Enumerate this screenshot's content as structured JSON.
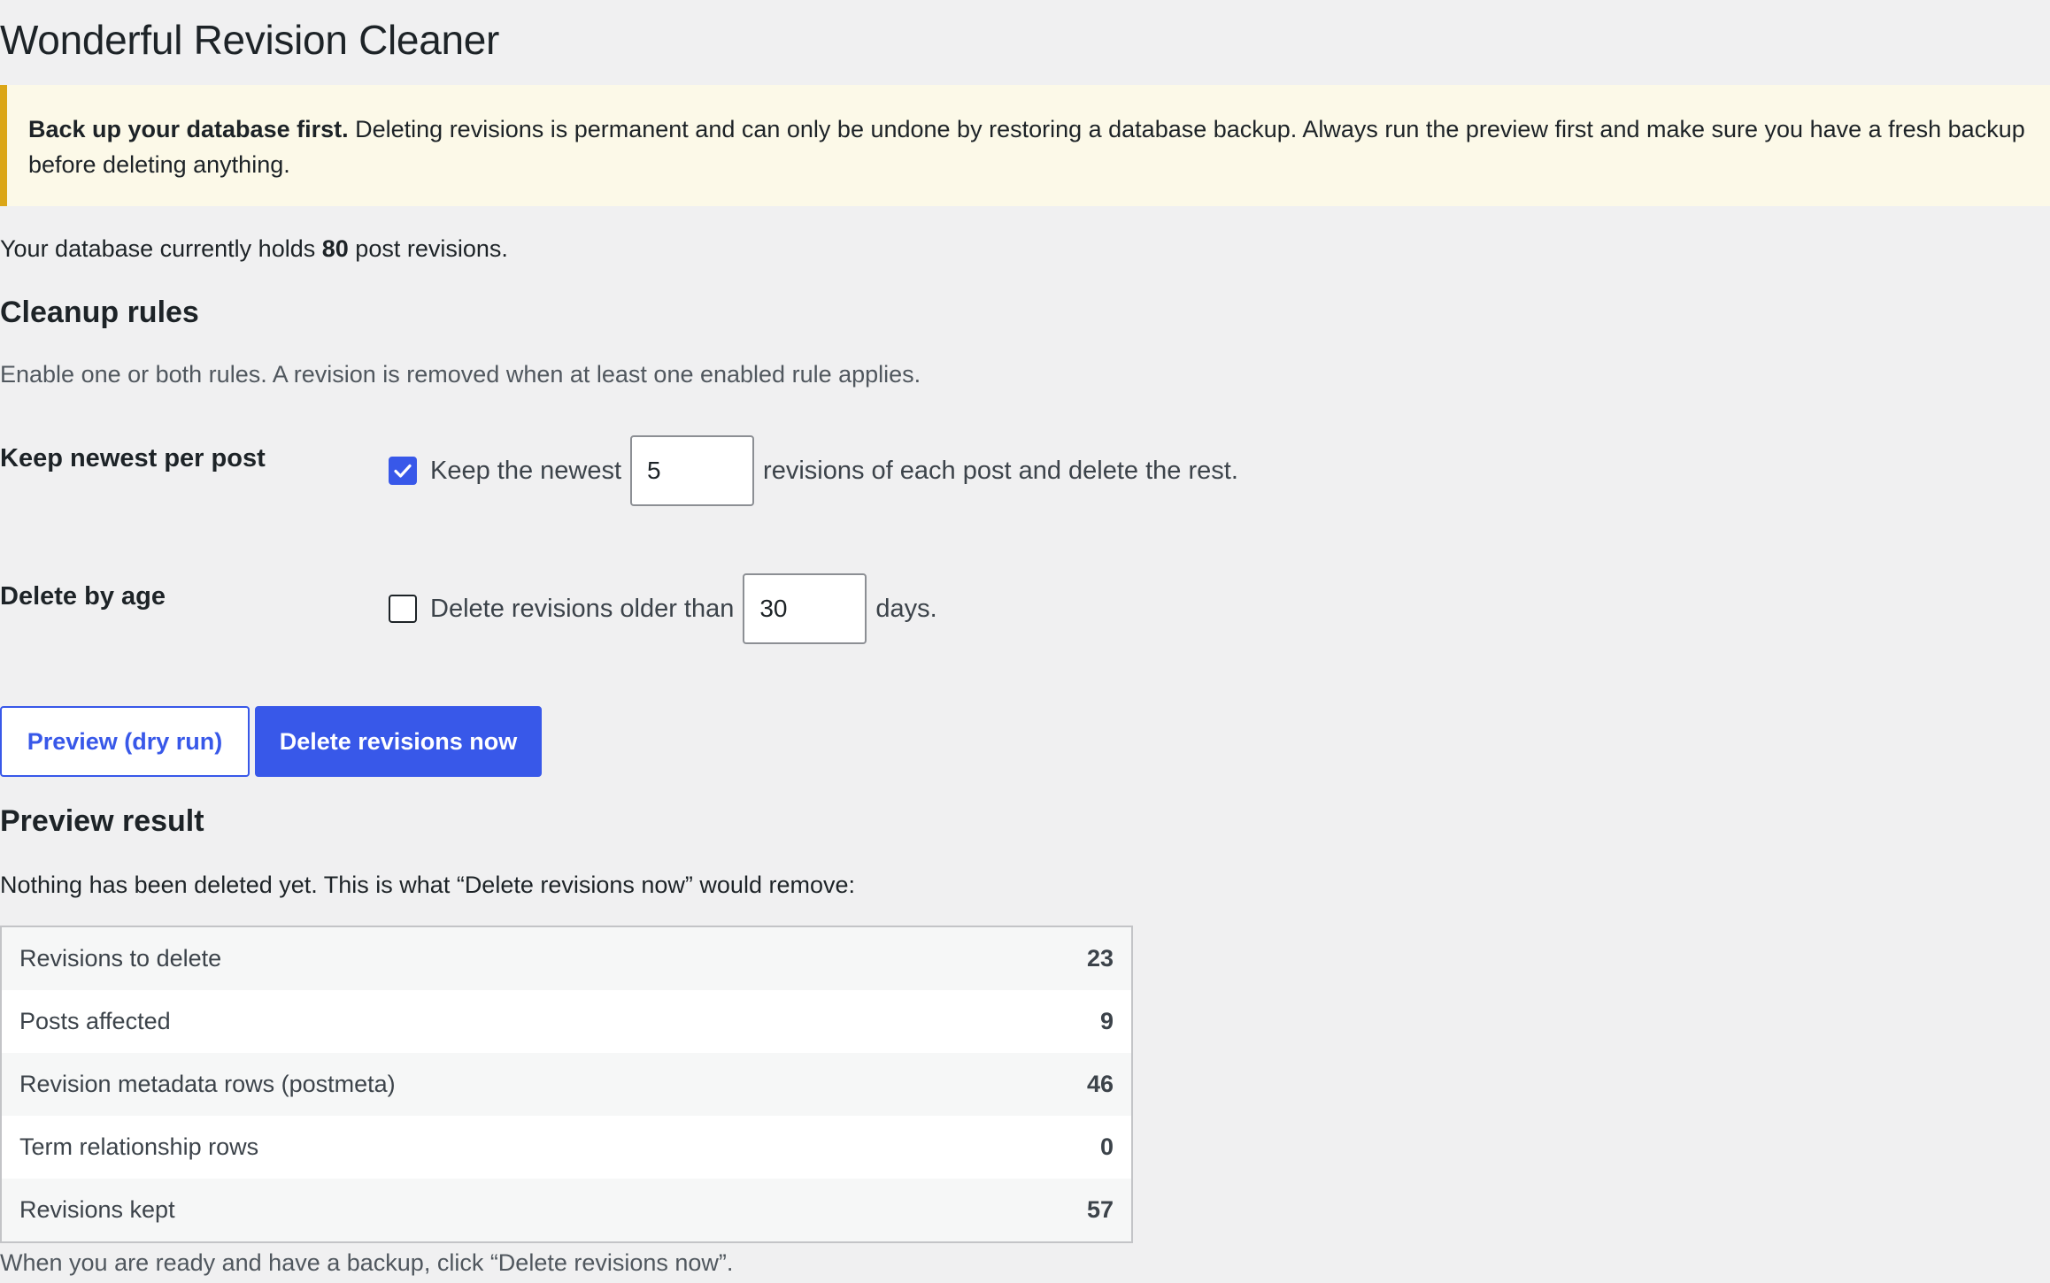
{
  "page": {
    "title": "Wonderful Revision Cleaner"
  },
  "notice": {
    "strong": "Back up your database first.",
    "text": " Deleting revisions is permanent and can only be undone by restoring a database backup. Always run the preview first and make sure you have a fresh backup before deleting anything."
  },
  "db": {
    "prefix": "Your database currently holds ",
    "count": "80",
    "suffix": " post revisions."
  },
  "cleanup": {
    "title": "Cleanup rules",
    "description": "Enable one or both rules. A revision is removed when at least one enabled rule applies.",
    "rules": [
      {
        "label": "Keep newest per post",
        "checked": true,
        "before": "Keep the newest",
        "value": "5",
        "after": "revisions of each post and delete the rest."
      },
      {
        "label": "Delete by age",
        "checked": false,
        "before": "Delete revisions older than",
        "value": "30",
        "after": "days."
      }
    ]
  },
  "buttons": {
    "preview": "Preview (dry run)",
    "delete": "Delete revisions now"
  },
  "preview": {
    "title": "Preview result",
    "note": "Nothing has been deleted yet. This is what “Delete revisions now” would remove:",
    "rows": [
      {
        "label": "Revisions to delete",
        "value": "23"
      },
      {
        "label": "Posts affected",
        "value": "9"
      },
      {
        "label": "Revision metadata rows (postmeta)",
        "value": "46"
      },
      {
        "label": "Term relationship rows",
        "value": "0"
      },
      {
        "label": "Revisions kept",
        "value": "57"
      }
    ],
    "footer": "When you are ready and have a backup, click “Delete revisions now”."
  },
  "colors": {
    "accent": "#3858e9",
    "notice_border": "#dba617",
    "notice_bg": "#fcf9e8",
    "page_bg": "#f0f0f1"
  }
}
